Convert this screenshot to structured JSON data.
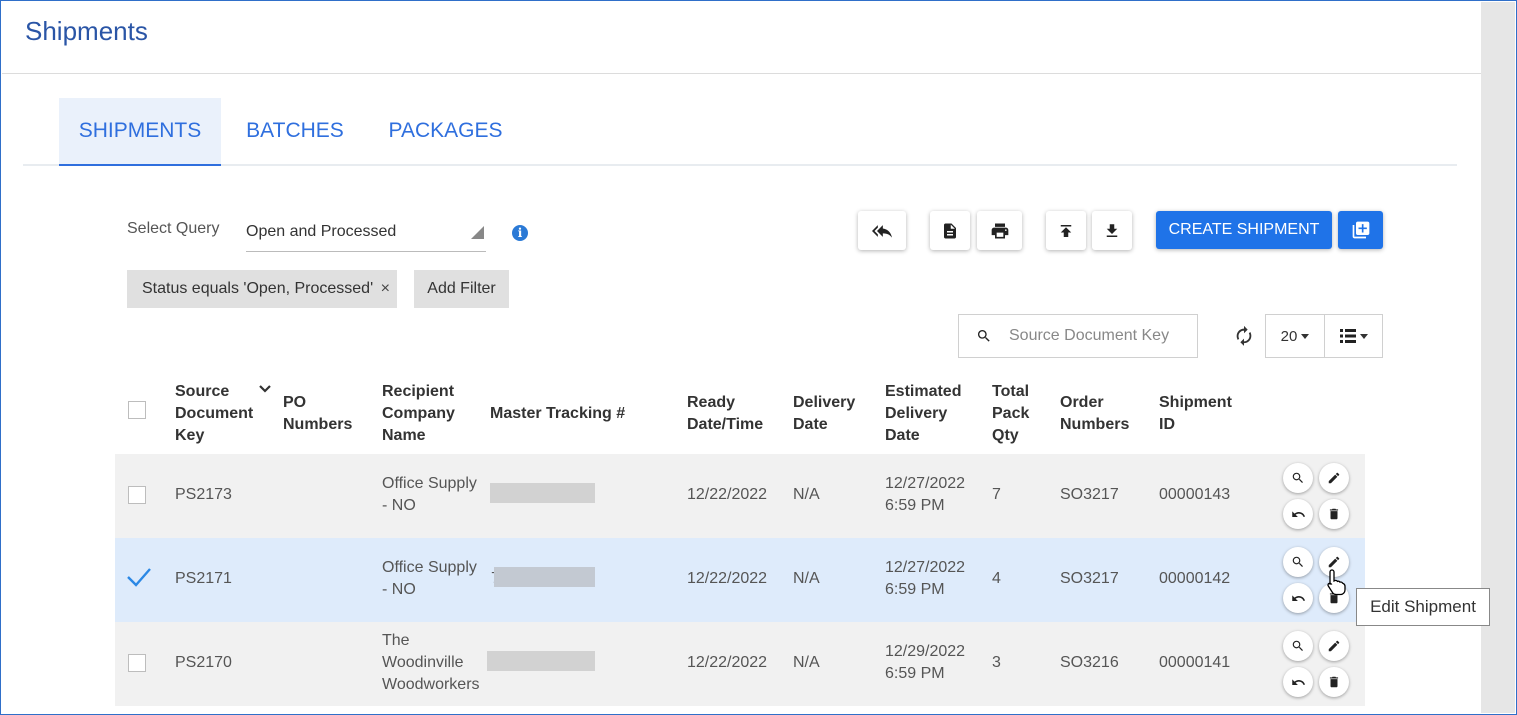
{
  "app": {
    "title": "Shipments"
  },
  "tabs": [
    {
      "label": "SHIPMENTS",
      "active": true
    },
    {
      "label": "BATCHES",
      "active": false
    },
    {
      "label": "PACKAGES",
      "active": false
    }
  ],
  "query": {
    "label": "Select Query",
    "value": "Open and Processed"
  },
  "filters": {
    "chip_label": "Status equals 'Open, Processed'",
    "remove_symbol": "×",
    "add_label": "Add Filter"
  },
  "toolbar": {
    "create_label": "CREATE SHIPMENT"
  },
  "search": {
    "placeholder": "Source Document Key"
  },
  "pager": {
    "page_size": "20"
  },
  "table": {
    "headers": {
      "source": [
        "Source",
        "Document",
        "Key"
      ],
      "po": [
        "PO",
        "Numbers"
      ],
      "recipient": [
        "Recipient",
        "Company",
        "Name"
      ],
      "tracking": [
        "Master Tracking #"
      ],
      "ready": [
        "Ready",
        "Date/Time"
      ],
      "delivery": [
        "Delivery",
        "Date"
      ],
      "estimated": [
        "Estimated",
        "Delivery",
        "Date"
      ],
      "qty": [
        "Total",
        "Pack",
        "Qty"
      ],
      "order": [
        "Order",
        "Numbers"
      ],
      "shipment": [
        "Shipment",
        "ID"
      ]
    },
    "rows": [
      {
        "source": "PS2173",
        "recipient": [
          "Office Supply",
          "- NO"
        ],
        "ready": "12/22/2022",
        "delivery": "N/A",
        "estimated": [
          "12/27/2022",
          "6:59 PM"
        ],
        "qty": "7",
        "order": "SO3217",
        "shipment": "00000143",
        "selected": false
      },
      {
        "source": "PS2171",
        "recipient": [
          "Office Supply",
          "- NO"
        ],
        "tracking_prefix": "7",
        "ready": "12/22/2022",
        "delivery": "N/A",
        "estimated": [
          "12/27/2022",
          "6:59 PM"
        ],
        "qty": "4",
        "order": "SO3217",
        "shipment": "00000142",
        "selected": true
      },
      {
        "source": "PS2170",
        "recipient": [
          "The",
          "Woodinville",
          "Woodworkers"
        ],
        "ready": "12/22/2022",
        "delivery": "N/A",
        "estimated": [
          "12/29/2022",
          "6:59 PM"
        ],
        "qty": "3",
        "order": "SO3216",
        "shipment": "00000141",
        "selected": false
      }
    ]
  },
  "tooltip": {
    "text": "Edit Shipment"
  },
  "colors": {
    "accent": "#1f73e8",
    "title": "#2a55a6",
    "row_alt": "#f1f1f1",
    "row_selected": "#deebfb",
    "check": "#2b88e5"
  },
  "icons": [
    "info-icon",
    "reply-all-icon",
    "document-icon",
    "print-icon",
    "upload-icon",
    "download-icon",
    "add-box-icon",
    "search-icon",
    "refresh-icon",
    "list-view-icon",
    "sort-chevron-icon",
    "view-icon",
    "edit-icon",
    "undo-icon",
    "delete-icon",
    "checkmark-icon",
    "pointer-cursor-icon"
  ]
}
